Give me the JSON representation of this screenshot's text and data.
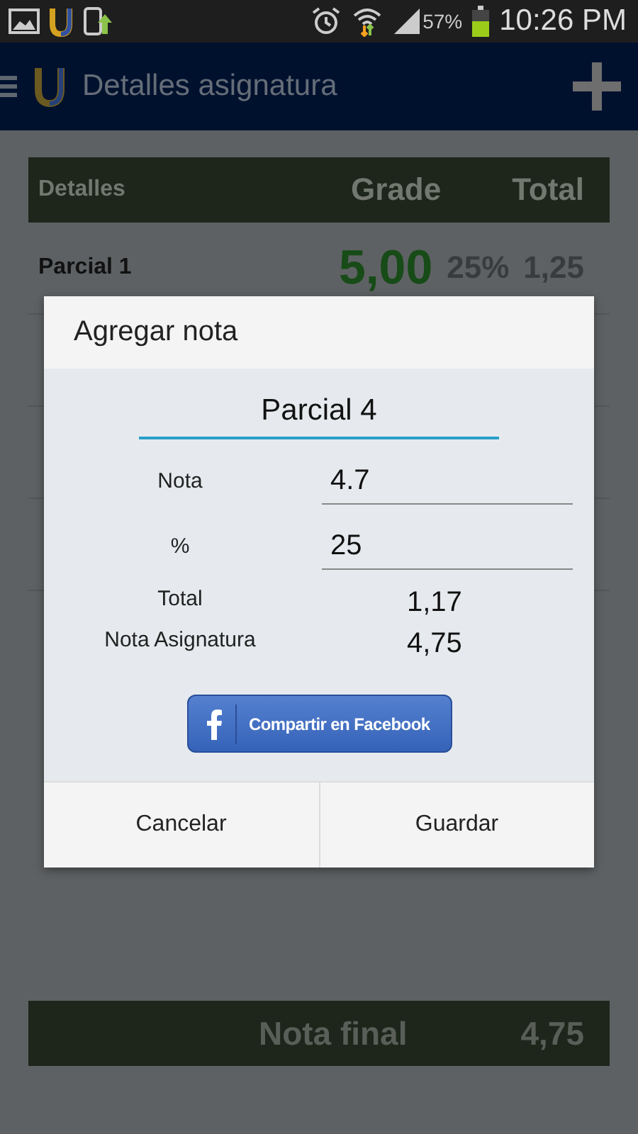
{
  "status_bar": {
    "battery_percent": "57%",
    "time": "10:26 PM"
  },
  "app_bar": {
    "title": "Detalles asignatura"
  },
  "table": {
    "columns": [
      "Detalles",
      "Grade",
      "Total"
    ],
    "rows": [
      {
        "label": "Parcial 1",
        "grade": "5,00",
        "percent": "25%",
        "total": "1,25"
      }
    ]
  },
  "footer": {
    "label": "Nota final",
    "value": "4,75"
  },
  "dialog": {
    "title": "Agregar nota",
    "name_field": {
      "value": "Parcial 4",
      "focused": true
    },
    "fields": [
      {
        "label": "Nota",
        "value": "4.7"
      },
      {
        "label": "%",
        "value": "25"
      }
    ],
    "results": [
      {
        "label": "Total",
        "value": "1,17"
      },
      {
        "label": "Nota Asignatura",
        "value": "4,75"
      }
    ],
    "share_button": "Compartir en Facebook",
    "buttons": [
      "Cancelar",
      "Guardar"
    ]
  }
}
